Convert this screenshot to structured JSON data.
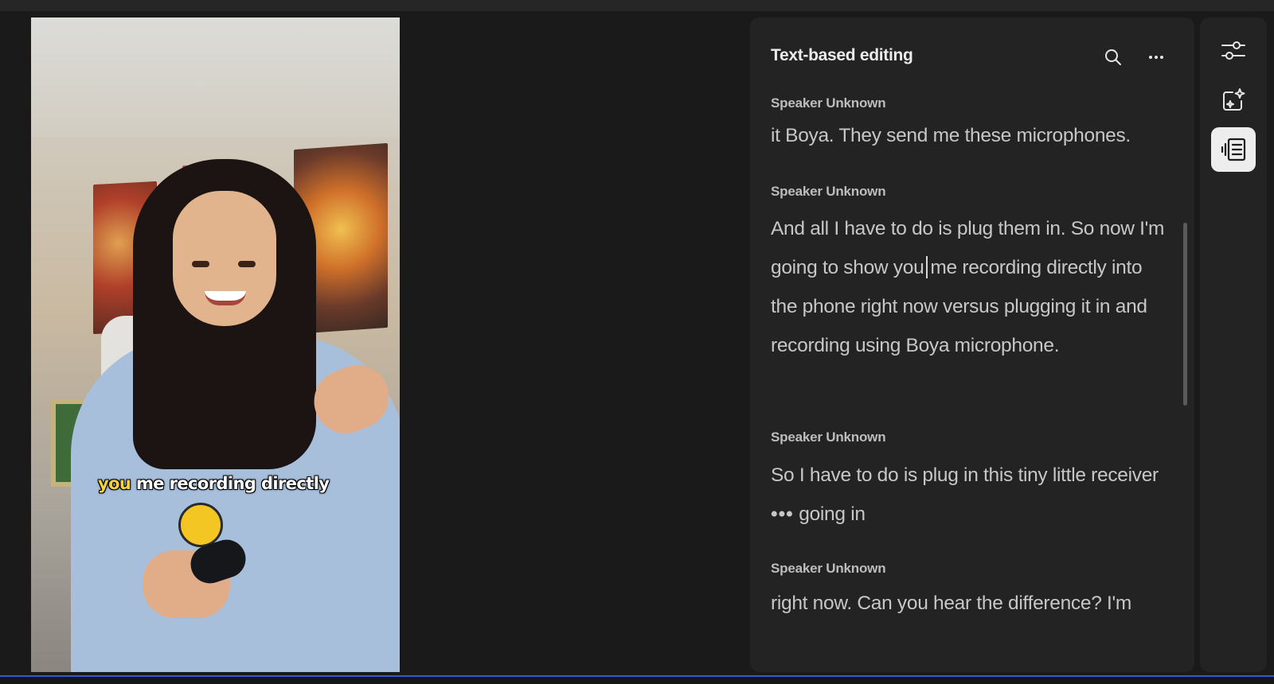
{
  "video": {
    "caption_highlight": "you",
    "caption_rest": " me recording directly"
  },
  "panel": {
    "title": "Text-based editing",
    "search_icon": "search-icon",
    "more_icon": "more-horizontal-icon"
  },
  "transcript": {
    "blocks": [
      {
        "speaker": "Speaker Unknown",
        "text": "it Boya. They send me these microphones."
      },
      {
        "speaker": "Speaker Unknown",
        "text_before_cursor": "And all I have to do is plug them in. So now I'm going to show you",
        "text_after_cursor": "me recording directly into the phone right now versus plugging it in and recording using Boya microphone."
      },
      {
        "speaker": "Speaker Unknown",
        "text_before_gap": "So I have to do is plug in this tiny little receiver",
        "gap": "•••",
        "text_after_gap": "going in"
      },
      {
        "speaker": "Speaker Unknown",
        "text": "right now. Can you hear the difference? I'm"
      }
    ]
  },
  "rail": {
    "items": [
      {
        "icon": "sliders-icon"
      },
      {
        "icon": "magic-enhance-icon"
      },
      {
        "icon": "transcript-icon",
        "active": true
      }
    ]
  },
  "colors": {
    "background": "#1a1a1a",
    "panel": "#232323",
    "timeline_accent": "#2e5bd6",
    "caption_highlight": "#f5d33a"
  }
}
